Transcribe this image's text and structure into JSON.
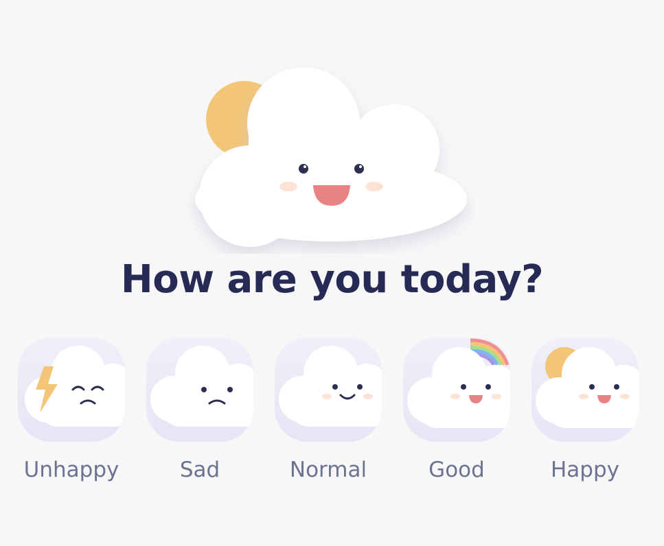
{
  "title": "How are you today?",
  "colors": {
    "background": "#f7f7f8",
    "title": "#262a55",
    "label": "#6c7292",
    "sun": "#f3c677",
    "cheek": "#fde3d6",
    "mouth": "#e88383"
  },
  "hero": {
    "icon": "happy-cloud-with-sun-icon"
  },
  "moods": [
    {
      "label": "Unhappy",
      "icon": "cloud-lightning-icon"
    },
    {
      "label": "Sad",
      "icon": "cloud-frown-icon"
    },
    {
      "label": "Normal",
      "icon": "cloud-smile-icon"
    },
    {
      "label": "Good",
      "icon": "cloud-rainbow-icon"
    },
    {
      "label": "Happy",
      "icon": "cloud-sun-icon"
    }
  ]
}
